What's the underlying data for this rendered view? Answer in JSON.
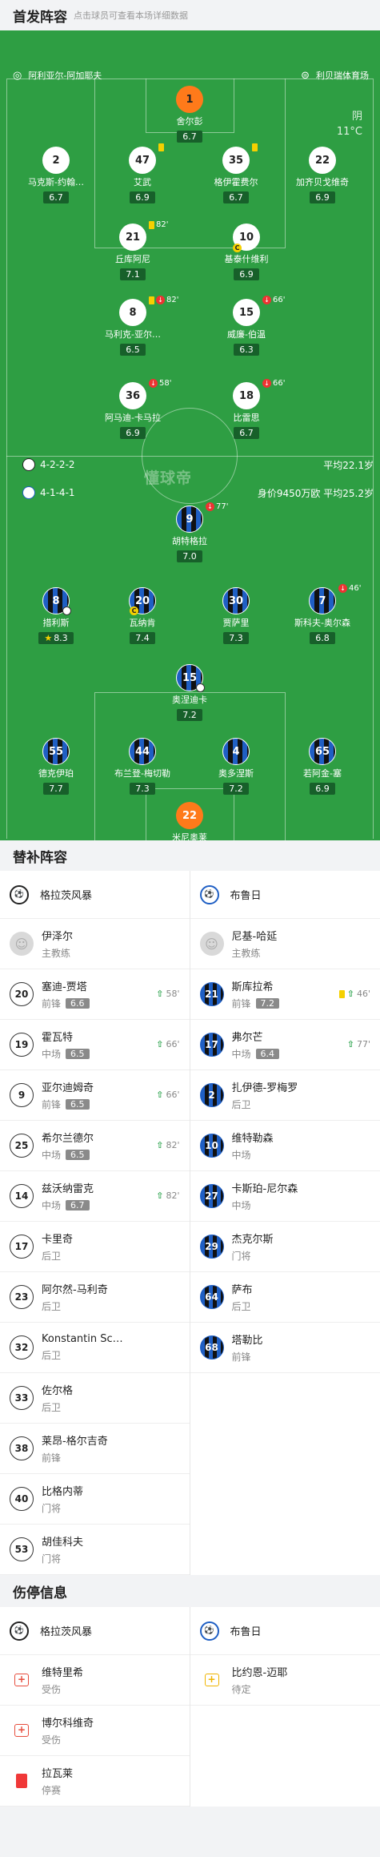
{
  "lineup": {
    "title": "首发阵容",
    "subtitle": "点击球员可查看本场详细数据"
  },
  "pitch": {
    "stadium_left": "阿利亚尔-阿加耶夫",
    "stadium_right": "利贝瑞体育场",
    "weather": "阴",
    "temperature": "11°C",
    "watermark": "懂球帝",
    "home_formation": "4-2-2-2",
    "home_avg_age": "平均22.1岁",
    "away_formation": "4-1-4-1",
    "away_value": "身价9450万欧",
    "away_avg_age": "平均25.2岁",
    "home_players": [
      {
        "num": "1",
        "name": "舍尔彭",
        "rating": "6.7"
      },
      {
        "num": "2",
        "name": "马克斯-约翰…",
        "rating": "6.7"
      },
      {
        "num": "47",
        "name": "艾武",
        "rating": "6.9"
      },
      {
        "num": "35",
        "name": "格伊霍费尔",
        "rating": "6.7"
      },
      {
        "num": "22",
        "name": "加齐贝戈维奇",
        "rating": "6.9"
      },
      {
        "num": "21",
        "name": "丘库阿尼",
        "rating": "7.1",
        "minute": "82'"
      },
      {
        "num": "10",
        "name": "基泰什维利",
        "rating": "6.9"
      },
      {
        "num": "8",
        "name": "马利克-亚尔…",
        "rating": "6.5",
        "minute": "82'"
      },
      {
        "num": "15",
        "name": "威廉-伯温",
        "rating": "6.3",
        "minute": "66'"
      },
      {
        "num": "36",
        "name": "阿马迪-卡马拉",
        "rating": "6.9",
        "minute": "58'"
      },
      {
        "num": "18",
        "name": "比雷思",
        "rating": "6.7",
        "minute": "66'"
      }
    ],
    "away_players": [
      {
        "num": "9",
        "name": "胡特格拉",
        "rating": "7.0",
        "minute": "77'"
      },
      {
        "num": "8",
        "name": "措利斯",
        "rating": "8.3"
      },
      {
        "num": "20",
        "name": "瓦纳肯",
        "rating": "7.4"
      },
      {
        "num": "30",
        "name": "贾萨里",
        "rating": "7.3"
      },
      {
        "num": "7",
        "name": "斯科夫-奥尔森",
        "rating": "6.8",
        "minute": "46'"
      },
      {
        "num": "15",
        "name": "奥涅迪卡",
        "rating": "7.2"
      },
      {
        "num": "55",
        "name": "德克伊珀",
        "rating": "7.7"
      },
      {
        "num": "44",
        "name": "布兰登-梅切勒",
        "rating": "7.3"
      },
      {
        "num": "4",
        "name": "奥多涅斯",
        "rating": "7.2"
      },
      {
        "num": "65",
        "name": "若阿金-塞",
        "rating": "6.9"
      },
      {
        "num": "22",
        "name": "米尼奥莱",
        "rating": "7.1"
      }
    ],
    "captain": "C"
  },
  "subs": {
    "title": "替补阵容",
    "home_team": "格拉茨风暴",
    "away_team": "布鲁日",
    "home_coach": {
      "name": "伊泽尔",
      "role": "主教练"
    },
    "away_coach": {
      "name": "尼基-哈延",
      "role": "主教练"
    },
    "home": [
      {
        "num": "20",
        "name": "塞迪-贾塔",
        "pos": "前锋",
        "rating": "6.6",
        "minute": "58'"
      },
      {
        "num": "19",
        "name": "霍瓦特",
        "pos": "中场",
        "rating": "6.5",
        "minute": "66'"
      },
      {
        "num": "9",
        "name": "亚尔迪姆奇",
        "pos": "前锋",
        "rating": "6.5",
        "minute": "66'"
      },
      {
        "num": "25",
        "name": "希尔兰德尔",
        "pos": "中场",
        "rating": "6.5",
        "minute": "82'"
      },
      {
        "num": "14",
        "name": "兹沃纳雷克",
        "pos": "中场",
        "rating": "6.7",
        "minute": "82'"
      },
      {
        "num": "17",
        "name": "卡里奇",
        "pos": "后卫"
      },
      {
        "num": "23",
        "name": "阿尔然-马利奇",
        "pos": "后卫"
      },
      {
        "num": "32",
        "name": "Konstantin Sc…",
        "pos": "后卫"
      },
      {
        "num": "33",
        "name": "佐尔格",
        "pos": "后卫"
      },
      {
        "num": "38",
        "name": "莱昂-格尔吉奇",
        "pos": "前锋"
      },
      {
        "num": "40",
        "name": "比格内蒂",
        "pos": "门将"
      },
      {
        "num": "53",
        "name": "胡佳科夫",
        "pos": "门将"
      }
    ],
    "away": [
      {
        "num": "21",
        "name": "斯库拉希",
        "pos": "前锋",
        "rating": "7.2",
        "minute": "46'"
      },
      {
        "num": "17",
        "name": "弗尔芒",
        "pos": "中场",
        "rating": "6.4",
        "minute": "77'"
      },
      {
        "num": "2",
        "name": "扎伊德-罗梅罗",
        "pos": "后卫"
      },
      {
        "num": "10",
        "name": "维特勒森",
        "pos": "中场"
      },
      {
        "num": "27",
        "name": "卡斯珀-尼尔森",
        "pos": "中场"
      },
      {
        "num": "29",
        "name": "杰克尔斯",
        "pos": "门将"
      },
      {
        "num": "64",
        "name": "萨布",
        "pos": "后卫"
      },
      {
        "num": "68",
        "name": "塔勒比",
        "pos": "前锋"
      }
    ]
  },
  "injuries": {
    "title": "伤停信息",
    "home_team": "格拉茨风暴",
    "away_team": "布鲁日",
    "home": [
      {
        "name": "维特里希",
        "status": "受伤"
      },
      {
        "name": "博尔科维奇",
        "status": "受伤"
      },
      {
        "name": "拉瓦莱",
        "status": "停赛"
      }
    ],
    "away": [
      {
        "name": "比约恩-迈耶",
        "status": "待定"
      }
    ]
  }
}
